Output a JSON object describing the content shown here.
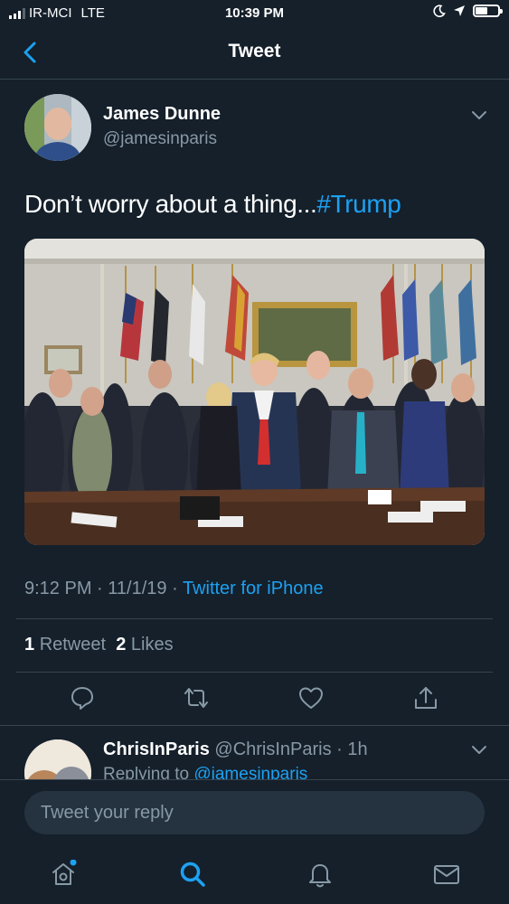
{
  "status_bar": {
    "carrier": "IR-MCI",
    "network": "LTE",
    "time": "10:39 PM"
  },
  "nav": {
    "title": "Tweet"
  },
  "tweet": {
    "author_name": "James Dunne",
    "author_handle": "@jamesinparis",
    "text": "Don’t worry about a thing...",
    "hashtag": "#Trump",
    "time": "9:12 PM",
    "separator": " · ",
    "date": "11/1/19",
    "source": "Twitter for iPhone",
    "retweet_count": "1",
    "retweet_label": "Retweet",
    "like_count": "2",
    "like_label": "Likes"
  },
  "reply": {
    "author_name": "ChrisInParis",
    "author_handle": "@ChrisInParis · 1h",
    "replying_to_label": "Replying to",
    "replying_to_handle": "@jamesinparis"
  },
  "compose": {
    "placeholder": "Tweet your reply"
  },
  "colors": {
    "background": "#15202b",
    "accent": "#1da1f2",
    "secondary_text": "#8899a6",
    "divider": "#38444d"
  },
  "icons": {
    "back": "chevron-left-icon",
    "menu": "chevron-down-icon",
    "reply": "comment-icon",
    "retweet": "retweet-icon",
    "like": "heart-icon",
    "share": "share-icon",
    "home": "home-icon",
    "search": "search-icon",
    "notifications": "bell-icon",
    "messages": "mail-icon"
  }
}
